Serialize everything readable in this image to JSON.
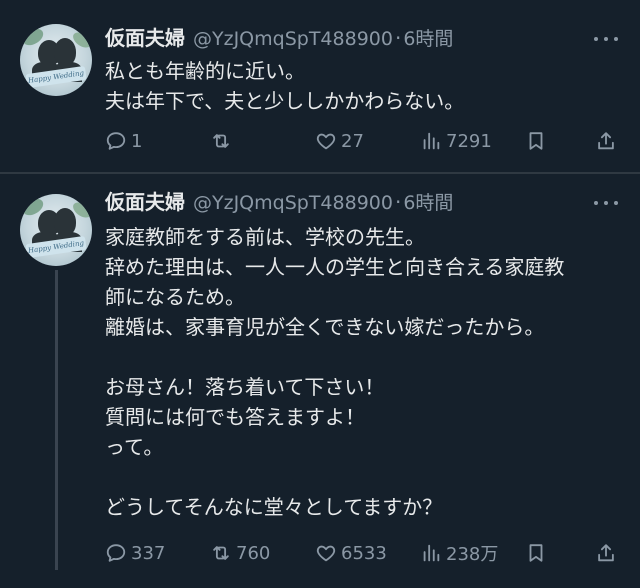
{
  "tweets": [
    {
      "author_name": "仮面夫婦",
      "handle": "@YzJQmqSpT488900",
      "separator": "·",
      "time": "6時間",
      "avatar_text": "Happy Wedding",
      "lines": [
        "私とも年齢的に近い。",
        "夫は年下で、夫と少ししかかわらない。"
      ],
      "replies": "1",
      "retweets": "",
      "likes": "27",
      "views": "7291"
    },
    {
      "author_name": "仮面夫婦",
      "handle": "@YzJQmqSpT488900",
      "separator": "·",
      "time": "6時間",
      "avatar_text": "Happy Wedding",
      "lines": [
        "家庭教師をする前は、学校の先生。",
        "辞めた理由は、一人一人の学生と向き合える家庭教",
        "師になるため。",
        "離婚は、家事育児が全くできない嫁だったから。",
        "",
        "お母さん！落ち着いて下さい！",
        "質問には何でも答えますよ！",
        "って。",
        "",
        "どうしてそんなに堂々としてますか？"
      ],
      "replies": "337",
      "retweets": "760",
      "likes": "6533",
      "views": "238万"
    }
  ],
  "icons": {
    "reply": "reply-icon",
    "retweet": "retweet-icon",
    "like": "heart-icon",
    "views": "views-icon",
    "bookmark": "bookmark-icon",
    "share": "share-icon",
    "more": "more-icon"
  },
  "colors": {
    "background": "#15202b",
    "text": "#e7e9ea",
    "secondary": "#8b98a5",
    "divider": "#2f3942"
  }
}
